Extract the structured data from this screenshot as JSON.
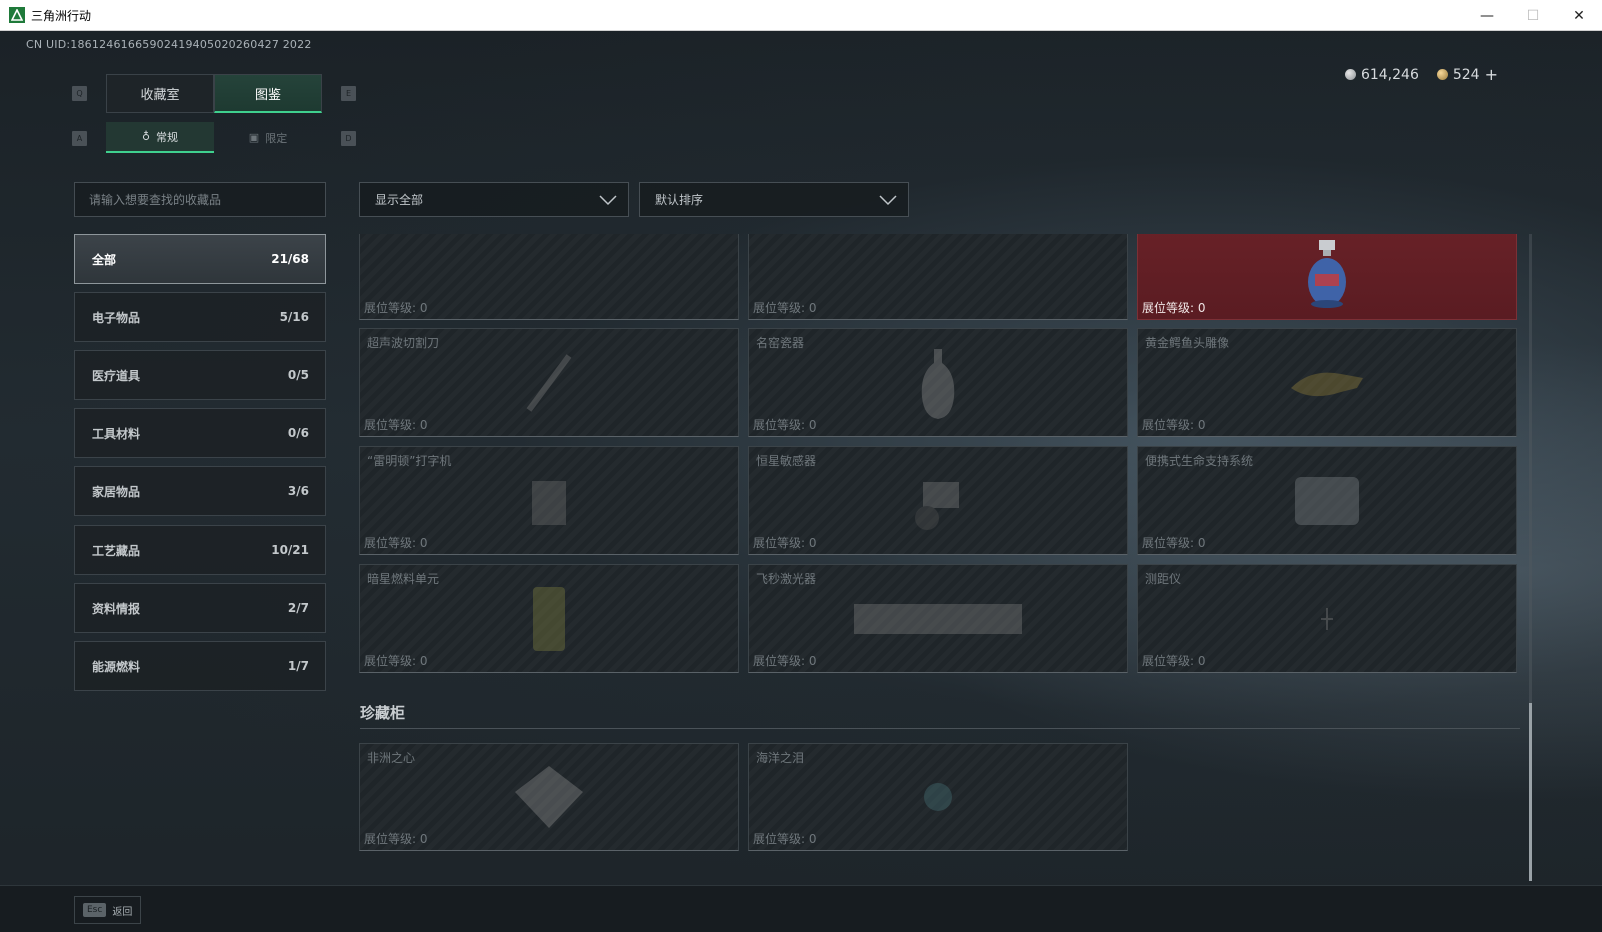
{
  "window": {
    "title": "三角洲行动",
    "minimize": "—",
    "maximize": "☐",
    "close": "✕"
  },
  "uid": "CN UID:18612461665902419405020260427 2022",
  "currency": {
    "silver": "614,246",
    "gold": "524",
    "plus": "+"
  },
  "main_tabs": {
    "key_left": "Q",
    "key_right": "E",
    "items": [
      {
        "label": "收藏室"
      },
      {
        "label": "图鉴"
      }
    ]
  },
  "sub_tabs": {
    "key_left": "A",
    "key_right": "D",
    "items": [
      {
        "label": "常规"
      },
      {
        "label": "限定"
      }
    ]
  },
  "search": {
    "placeholder": "请输入想要查找的收藏品"
  },
  "filters": {
    "show": "显示全部",
    "sort": "默认排序"
  },
  "categories": [
    {
      "label": "全部",
      "count": "21/68"
    },
    {
      "label": "电子物品",
      "count": "5/16"
    },
    {
      "label": "医疗道具",
      "count": "0/5"
    },
    {
      "label": "工具材料",
      "count": "0/6"
    },
    {
      "label": "家居物品",
      "count": "3/6"
    },
    {
      "label": "工艺藏品",
      "count": "10/21"
    },
    {
      "label": "资料情报",
      "count": "2/7"
    },
    {
      "label": "能源燃料",
      "count": "1/7"
    }
  ],
  "cards": [
    {
      "name": "",
      "level": "展位等级: 0"
    },
    {
      "name": "",
      "level": "展位等级: 0"
    },
    {
      "name": "",
      "level": "展位等级: 0"
    },
    {
      "name": "超声波切割刀",
      "level": "展位等级: 0"
    },
    {
      "name": "名窑瓷器",
      "level": "展位等级: 0"
    },
    {
      "name": "黄金鳄鱼头雕像",
      "level": "展位等级: 0"
    },
    {
      "name": "“雷明顿”打字机",
      "level": "展位等级: 0"
    },
    {
      "name": "恒星敏感器",
      "level": "展位等级: 0"
    },
    {
      "name": "便携式生命支持系统",
      "level": "展位等级: 0"
    },
    {
      "name": "暗星燃料单元",
      "level": "展位等级: 0"
    },
    {
      "name": "飞秒激光器",
      "level": "展位等级: 0"
    },
    {
      "name": "测距仪",
      "level": "展位等级: 0"
    }
  ],
  "section": {
    "title": "珍藏柜",
    "cards": [
      {
        "name": "非洲之心",
        "level": "展位等级: 0"
      },
      {
        "name": "海洋之泪",
        "level": "展位等级: 0"
      }
    ]
  },
  "bottom": {
    "esc_key": "Esc",
    "back_label": "返回"
  },
  "colors": {
    "accent_green": "#3fd08e",
    "highlight_red": "#6b2228"
  }
}
